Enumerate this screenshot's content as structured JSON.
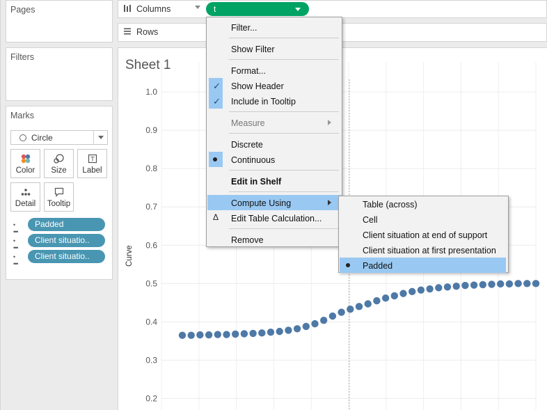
{
  "panels": {
    "pages": "Pages",
    "filters": "Filters",
    "marks": "Marks"
  },
  "marks": {
    "type": "Circle",
    "buttons": [
      "Color",
      "Size",
      "Label",
      "Detail",
      "Tooltip"
    ],
    "fields": [
      "Padded",
      "Client situatio..",
      "Client situatio.."
    ],
    "colors": {
      "pill": "#4996b2"
    }
  },
  "shelves": {
    "columns": "Columns",
    "rows": "Rows",
    "columns_pill": "t"
  },
  "sheet": {
    "title": "Sheet 1",
    "y_axis_title": "Curve",
    "y_ticks": [
      "1.0",
      "0.9",
      "0.8",
      "0.7",
      "0.6",
      "0.5",
      "0.4",
      "0.3",
      "0.2"
    ]
  },
  "context_menu": {
    "items": {
      "filter": "Filter...",
      "show_filter": "Show Filter",
      "format": "Format...",
      "show_header": "Show Header",
      "include_tooltip": "Include in Tooltip",
      "measure": "Measure",
      "discrete": "Discrete",
      "continuous": "Continuous",
      "edit_in_shelf": "Edit in Shelf",
      "compute_using": "Compute Using",
      "edit_table_calc": "Edit Table Calculation...",
      "remove": "Remove"
    },
    "highlight_color": "#99c9f2"
  },
  "compute_submenu": {
    "items": [
      "Table (across)",
      "Cell",
      "Client situation at end of support",
      "Client situation at first presentation",
      "Padded"
    ],
    "selected": "Padded"
  },
  "chart_data": {
    "type": "scatter",
    "ylabel": "Curve",
    "ylim": [
      0.17,
      1.06
    ],
    "yticks": [
      0.2,
      0.3,
      0.4,
      0.5,
      0.6,
      0.7,
      0.8,
      0.9,
      1.0
    ],
    "mark_color": "#4e79a7",
    "series": [
      {
        "x": [
          0,
          1,
          2,
          3,
          4,
          5,
          6,
          7,
          8,
          9,
          10,
          11,
          12,
          13,
          14,
          15,
          16,
          17,
          18,
          19,
          20,
          21,
          22,
          23,
          24,
          25,
          26,
          27,
          28,
          29,
          30,
          31,
          32,
          33,
          34,
          35,
          36,
          37,
          38,
          39,
          40
        ],
        "y": [
          0.365,
          0.365,
          0.366,
          0.366,
          0.367,
          0.367,
          0.368,
          0.369,
          0.37,
          0.371,
          0.373,
          0.375,
          0.378,
          0.382,
          0.388,
          0.395,
          0.404,
          0.415,
          0.425,
          0.433,
          0.44,
          0.447,
          0.455,
          0.462,
          0.468,
          0.474,
          0.479,
          0.483,
          0.486,
          0.489,
          0.491,
          0.493,
          0.495,
          0.496,
          0.497,
          0.498,
          0.499,
          0.499,
          0.5,
          0.5,
          0.5
        ]
      }
    ]
  }
}
